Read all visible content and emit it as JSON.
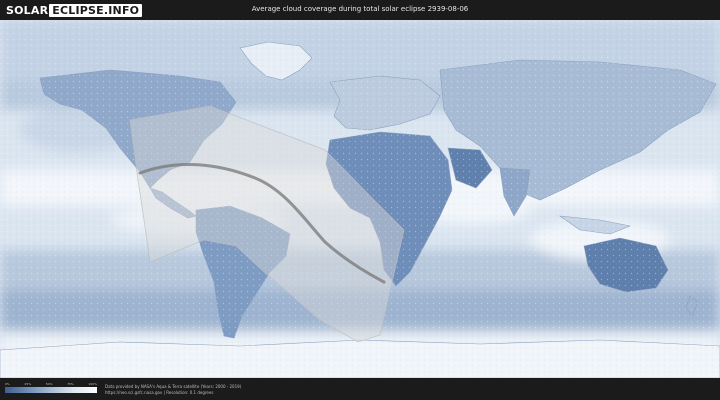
{
  "header": {
    "logo_part1": "SOLAR",
    "logo_part2": "ECLIPSE.INFO",
    "title": "Average cloud coverage during total solar eclipse 2939-08-06"
  },
  "footer": {
    "scale_labels": [
      "0%",
      "25%",
      "50%",
      "75%",
      "100%"
    ],
    "credit_line1": "Data provided by NASA's Aqua & Terra satellite (Years: 2000 - 2019)",
    "credit_line2": "https://neo.sci.gsfc.nasa.gov | Resolution: 0.1 degrees"
  },
  "map": {
    "ocean_color": "#dfe7f1",
    "cloud_high_color": "#f4f7fb",
    "cloud_low_color": "#6a86ae",
    "land_border_color": "#8aa0bf",
    "eclipse_band_color": "#d9d9d9",
    "eclipse_centerline_color": "#777777"
  }
}
